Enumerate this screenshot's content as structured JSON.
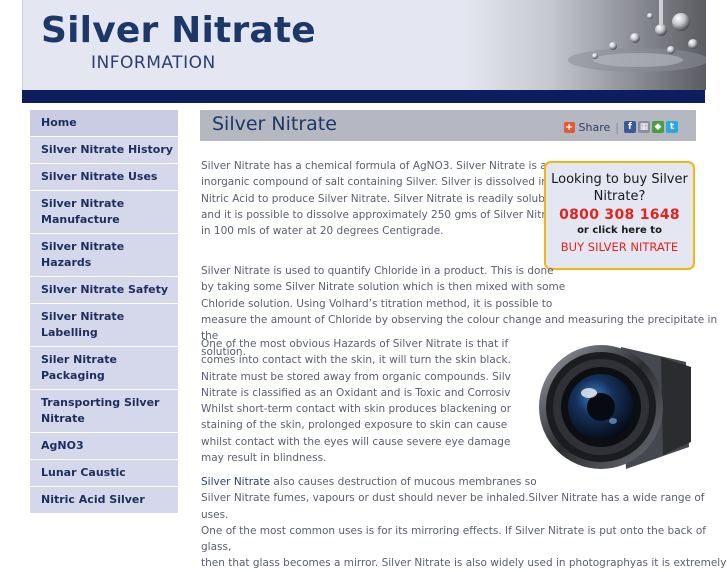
{
  "header": {
    "title": "Silver Nitrate",
    "subtitle": "INFORMATION"
  },
  "sidebar": {
    "items": [
      {
        "label": "Home"
      },
      {
        "label": "Silver Nitrate History"
      },
      {
        "label": "Silver Nitrate Uses"
      },
      {
        "label": "Silver Nitrate Manufacture"
      },
      {
        "label": "Silver Nitrate Hazards"
      },
      {
        "label": "Silver Nitrate Safety"
      },
      {
        "label": "Silver Nitrate Labelling"
      },
      {
        "label": "Siler Nitrate Packaging"
      },
      {
        "label": "Transporting Silver Nitrate"
      },
      {
        "label": "AgNO3"
      },
      {
        "label": "Lunar Caustic"
      },
      {
        "label": "Nitric Acid Silver"
      }
    ]
  },
  "main": {
    "title": "Silver Nitrate",
    "share_label": "Share",
    "share_separator": "|",
    "share_icons": [
      "share-plus-icon",
      "facebook-icon",
      "bookmark-icon",
      "delicious-icon",
      "twitter-icon"
    ],
    "paragraph1_lines": [
      "Silver Nitrate has a chemical formula of AgNO3. Silver Nitrate is an",
      "inorganic compound of salt containing Silver. Silver is dissolved in",
      "Nitric Acid to produce Silver Nitrate. Silver Nitrate is readily soluble",
      "and it is possible to dissolve approximately 250 gms of Silver Nitrate",
      "in 100 mls of water at 20 degrees Centigrade."
    ],
    "paragraph2_lines": [
      "Silver Nitrate is used to quantify Chloride in a product. This is done",
      "by taking some Silver Nitrate solution which is then mixed with some",
      "Chloride solution. Using Volhard’s titration method, it is possible to",
      "measure the amount of Chloride by observing the colour change and measuring the precipitate in the",
      "solution."
    ],
    "paragraph3_lines": [
      "One of the most obvious Hazards of Silver Nitrate is that if it",
      "comes into contact with the skin, it will turn the skin black. Silver",
      "Nitrate must be stored away from organic compounds. Silver",
      "Nitrate is classified as an Oxidant and is Toxic and Corrosive.",
      "Whilst short-term contact with skin produces blackening or",
      "staining of the skin, prolonged exposure  to skin can cause burns",
      "whilst contact with the eyes will cause severe eye damage and",
      "may result in blindness."
    ],
    "paragraph4_link": "Silver Nitrate",
    "paragraph4_first": " also causes destruction of mucous membranes so",
    "paragraph4_lines": [
      "Silver Nitrate fumes, vapours or dust should never be inhaled.Silver Nitrate has a wide range of uses.",
      "One of the most common uses is for its mirroring effects. If Silver Nitrate is put onto the back of glass,",
      "then that glass becomes a mirror. Silver Nitrate is also widely used in photographyas it is extremely"
    ]
  },
  "buy_box": {
    "question": "Looking to buy Silver Nitrate?",
    "phone": "0800 308 1648",
    "click_text": "or click here to",
    "link": "BUY SILVER NITRATE"
  },
  "image": {
    "type": "camera-lens-photo"
  },
  "colors": {
    "header_bg": "#e4e6f1",
    "nav_bar": "#0e1d5e",
    "title_color": "#1c3869",
    "sidebar_bg": "#d5d8ea",
    "accent_red": "#e3231c",
    "box_border": "#f2b516"
  }
}
